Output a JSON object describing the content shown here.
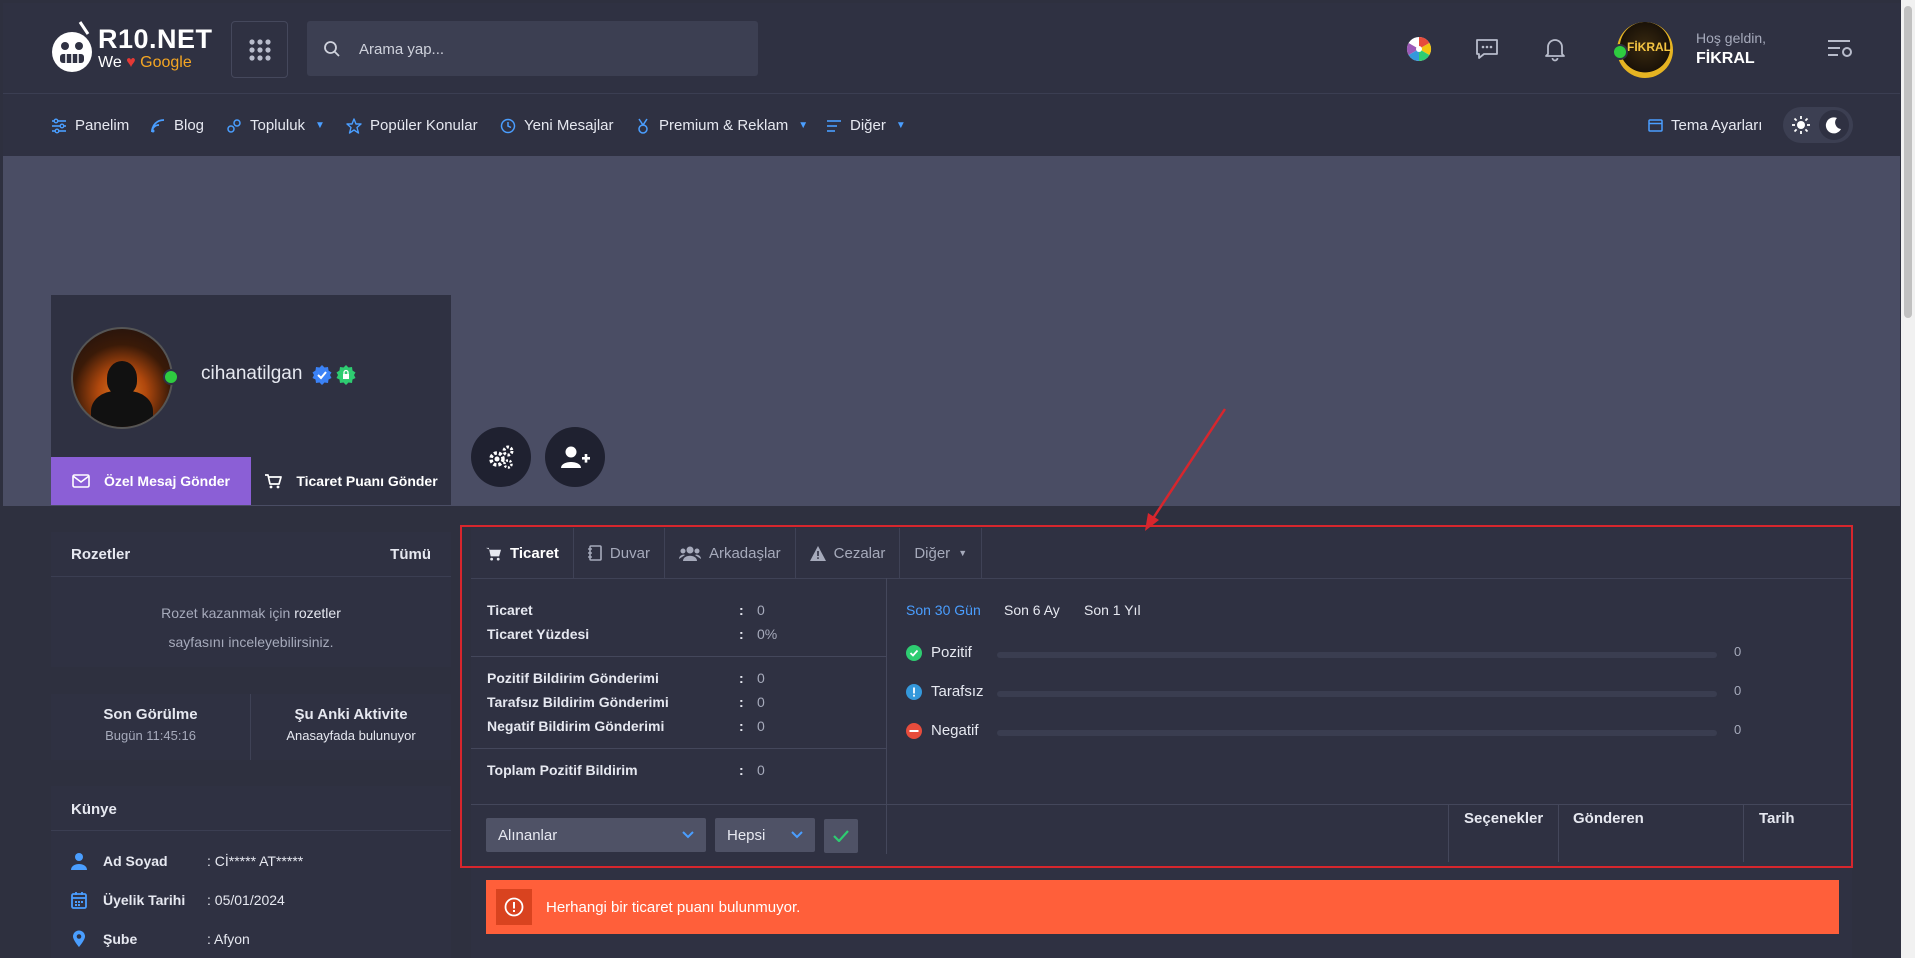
{
  "header": {
    "logo_title": "R10.NET",
    "logo_we": "We",
    "logo_google": "Google",
    "search_placeholder": "Arama yap...",
    "greeting": "Hoş geldin,",
    "username": "FİKRAL",
    "avatar_text": "FİKRAL"
  },
  "nav": {
    "items": [
      {
        "label": "Panelim",
        "icon": "sliders-icon"
      },
      {
        "label": "Blog",
        "icon": "blog-icon"
      },
      {
        "label": "Topluluk",
        "icon": "community-icon"
      },
      {
        "label": "Popüler Konular",
        "icon": "star-icon"
      },
      {
        "label": "Yeni Mesajlar",
        "icon": "chat-clock-icon"
      },
      {
        "label": "Premium & Reklam",
        "icon": "medal-icon"
      },
      {
        "label": "Diğer",
        "icon": "list-icon"
      }
    ],
    "theme_settings": "Tema Ayarları"
  },
  "profile": {
    "name": "cihanatilgan",
    "send_message": "Özel Mesaj Gönder",
    "send_trade_point": "Ticaret Puanı Gönder"
  },
  "badges": {
    "title": "Rozetler",
    "all_link": "Tümü",
    "text_before": "Rozet kazanmak için",
    "link": "rozetler",
    "text_after": "sayfasını inceleyebilirsiniz."
  },
  "activity": {
    "last_seen_label": "Son Görülme",
    "last_seen_value": "Bugün 11:45:16",
    "current_label": "Şu Anki Aktivite",
    "current_value": "Anasayfada bulunuyor"
  },
  "identity": {
    "title": "Künye",
    "rows": [
      {
        "label": "Ad Soyad",
        "value": ": Cİ***** AT*****"
      },
      {
        "label": "Üyelik Tarihi",
        "value": ": 05/01/2024"
      },
      {
        "label": "Şube",
        "value": ": Afyon"
      }
    ]
  },
  "tabs": [
    {
      "label": "Ticaret",
      "icon": "cart-icon"
    },
    {
      "label": "Duvar",
      "icon": "notebook-icon"
    },
    {
      "label": "Arkadaşlar",
      "icon": "users-icon"
    },
    {
      "label": "Cezalar",
      "icon": "warning-icon"
    },
    {
      "label": "Diğer",
      "icon": "caret-icon"
    }
  ],
  "trade_stats": {
    "group1": [
      {
        "label": "Ticaret",
        "value": "0"
      },
      {
        "label": "Ticaret Yüzdesi",
        "value": "0%"
      }
    ],
    "group2": [
      {
        "label": "Pozitif Bildirim Gönderimi",
        "value": "0"
      },
      {
        "label": "Tarafsız Bildirim Gönderimi",
        "value": "0"
      },
      {
        "label": "Negatif Bildirim Gönderimi",
        "value": "0"
      }
    ],
    "group3": [
      {
        "label": "Toplam Pozitif Bildirim",
        "value": "0"
      }
    ]
  },
  "periods": [
    "Son 30 Gün",
    "Son 6 Ay",
    "Son 1 Yıl"
  ],
  "ratings": [
    {
      "label": "Pozitif",
      "value": "0",
      "color": "#2ecc71"
    },
    {
      "label": "Tarafsız",
      "value": "0",
      "color": "#3498db"
    },
    {
      "label": "Negatif",
      "value": "0",
      "color": "#e74c3c"
    }
  ],
  "filters": {
    "received": "Alınanlar",
    "all": "Hepsi"
  },
  "table_headers": {
    "options": "Seçenekler",
    "sender": "Gönderen",
    "date": "Tarih"
  },
  "alert_text": "Herhangi bir ticaret puanı bulunmuyor.",
  "colors": {
    "accent_blue": "#4a9eff",
    "purple_button": "#8b5fd6",
    "alert_orange": "#ff5f3a",
    "highlight_red": "#d7262d"
  }
}
